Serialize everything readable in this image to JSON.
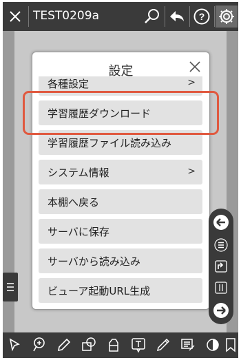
{
  "header": {
    "title": "TEST0209a",
    "icons": [
      "close-icon",
      "search-icon",
      "back-arrow-icon",
      "help-icon",
      "settings-gear-icon"
    ]
  },
  "dialog": {
    "title": "設定",
    "items": [
      {
        "label": "各種設定",
        "has_chevron": true,
        "chevron": ">"
      },
      {
        "label": "学習履歴ダウンロード",
        "has_chevron": false
      },
      {
        "label": "学習履歴ファイル読み込み",
        "has_chevron": false
      },
      {
        "label": "システム情報",
        "has_chevron": true,
        "chevron": ">"
      },
      {
        "label": "本棚へ戻る",
        "has_chevron": false
      },
      {
        "label": "サーバに保存",
        "has_chevron": false
      },
      {
        "label": "サーバから読み込み",
        "has_chevron": false
      },
      {
        "label": "ビューア起動URL生成",
        "has_chevron": false
      }
    ]
  },
  "highlighted_item": "学習履歴ダウンロード",
  "colors": {
    "bar": "#3a3a3a",
    "canvas": "#c8c8c8",
    "item_bg": "#e2e2e2",
    "highlight": "#e0593f"
  }
}
